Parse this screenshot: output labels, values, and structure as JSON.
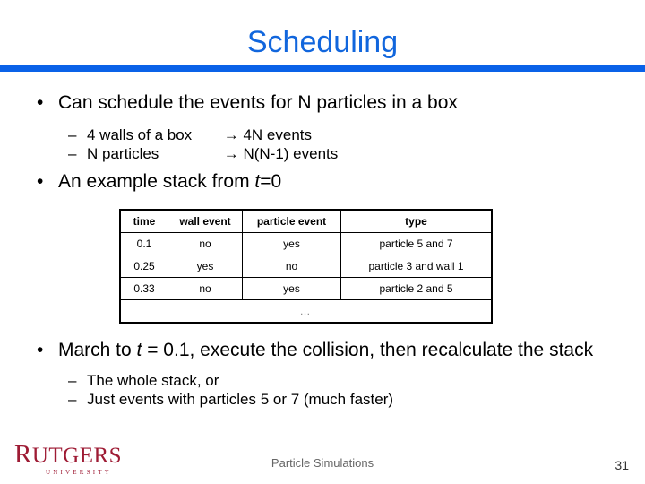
{
  "slide": {
    "title": "Scheduling",
    "accent_color": "#0a62e8",
    "title_color": "#1166dd"
  },
  "bullets": {
    "b1": "Can schedule the events for N particles in a box",
    "b1_sub": [
      {
        "left": "4 walls of a box",
        "right": "→ 4N events"
      },
      {
        "left": "N particles",
        "right": "→ N(N-1) events"
      }
    ],
    "b2_pre": "An example stack from ",
    "b2_italic": "t",
    "b2_post": "=0",
    "b3_pre": "March to ",
    "b3_italic": "t",
    "b3_post": " = 0.1, execute the collision, then recalculate the stack",
    "b3_sub": [
      "The whole stack, or",
      "Just events with particles 5 or 7 (much faster)"
    ],
    "marker_l1": "•",
    "marker_l2": "–"
  },
  "table": {
    "headers": [
      "time",
      "wall event",
      "particle event",
      "type"
    ],
    "rows": [
      [
        "0.1",
        "no",
        "yes",
        "particle 5 and 7"
      ],
      [
        "0.25",
        "yes",
        "no",
        "particle 3 and wall 1"
      ],
      [
        "0.33",
        "no",
        "yes",
        "particle 2 and 5"
      ]
    ],
    "ellipsis_row": "…"
  },
  "footer": {
    "logo_cap": "R",
    "logo_rest": "UTGERS",
    "logo_sub": "UNIVERSITY",
    "logo_color": "#9e1b34",
    "center_text": "Particle Simulations",
    "page_number": "31"
  }
}
